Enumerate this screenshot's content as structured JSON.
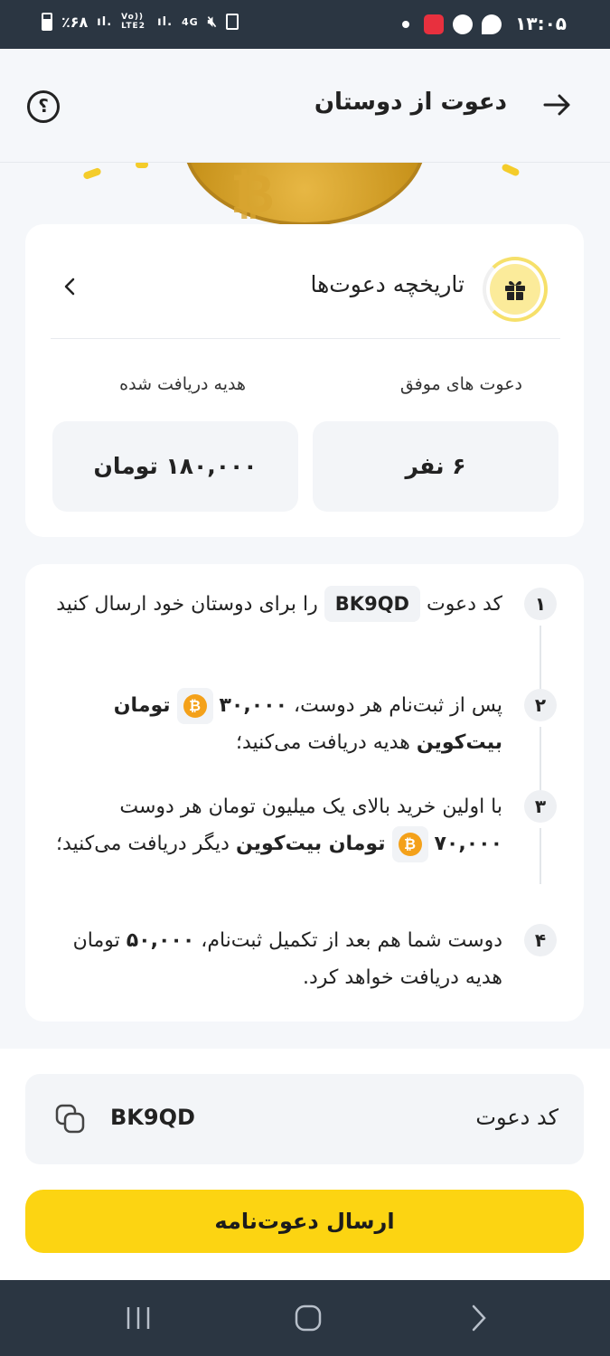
{
  "status_bar": {
    "time": "۱۳:۰۵",
    "battery": "٪۶۸",
    "network_labels": [
      "Vo)) LTE2",
      "4G"
    ]
  },
  "header": {
    "title": "دعوت از دوستان",
    "back_icon": "arrow-right-icon",
    "help_icon": "question-circle-icon",
    "help_glyph": "؟"
  },
  "history": {
    "label": "تاریخچه دعوت‌ها",
    "icon": "gift-icon"
  },
  "stats": {
    "successful_label": "دعوت های موفق",
    "successful_value": "۶ نفر",
    "reward_label": "هدیه دریافت شده",
    "reward_value": "۱۸۰,۰۰۰ تومان"
  },
  "steps": [
    {
      "num": "۱",
      "before": "کد دعوت",
      "code": "BK9QD",
      "after": "را برای دوستان خود ارسال کنید"
    },
    {
      "num": "۲",
      "before": "پس از ثبت‌نام هر دوست،",
      "amount": "۳۰,۰۰۰",
      "bold": "تومان بیت‌کوین",
      "after": "هدیه دریافت می‌کنید؛"
    },
    {
      "num": "۳",
      "before": "با اولین خرید بالای یک میلیون تومان هر دوست",
      "amount": "۷۰,۰۰۰",
      "bold": "تومان بیت‌کوین",
      "after": "دیگر دریافت می‌کنید؛"
    },
    {
      "num": "۴",
      "before": "دوست شما هم بعد از تکمیل ثبت‌نام،",
      "amount": "۵۰,۰۰۰",
      "after": "تومان هدیه دریافت خواهد کرد."
    }
  ],
  "invite_code": {
    "label": "کد دعوت",
    "value": "BK9QD",
    "copy_icon": "copy-icon"
  },
  "send_button": "ارسال دعوت‌نامه",
  "colors": {
    "accent": "#fcd412",
    "bitcoin": "#f4a11a",
    "bar_bg": "#2b3642"
  }
}
